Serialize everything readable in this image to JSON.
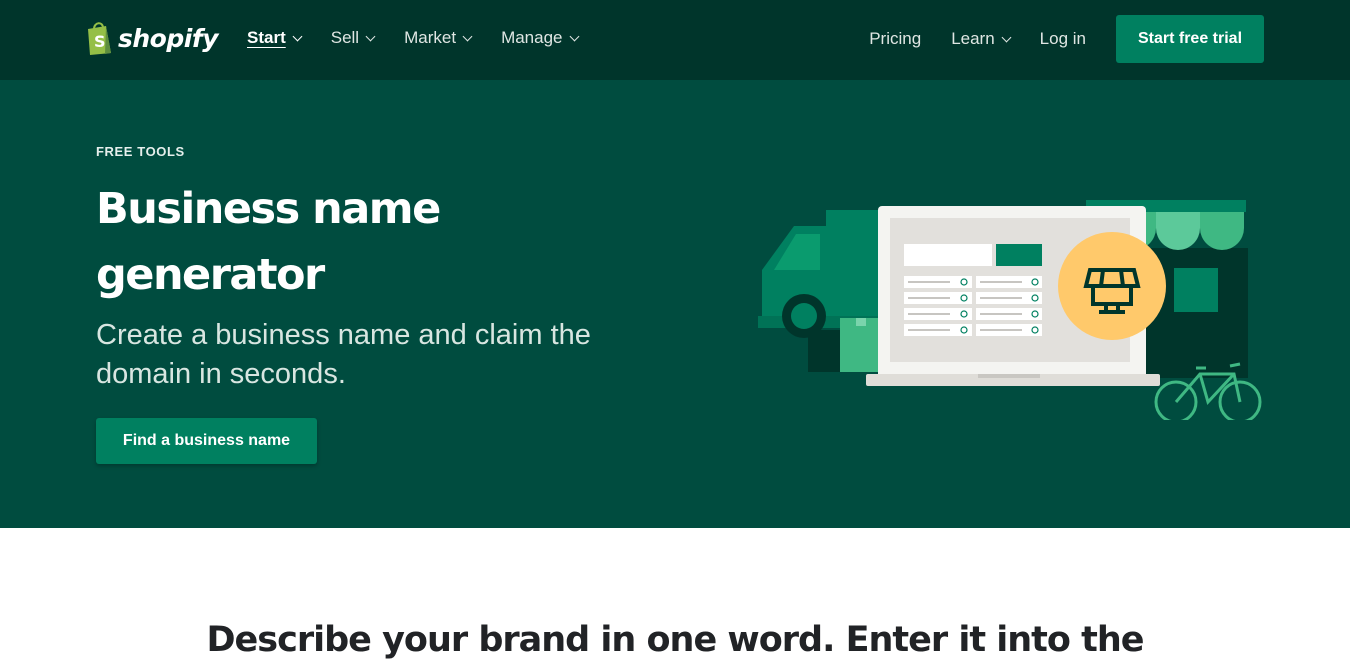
{
  "header": {
    "brand": "shopify",
    "nav_left": [
      {
        "label": "Start",
        "active": true
      },
      {
        "label": "Sell",
        "active": false
      },
      {
        "label": "Market",
        "active": false
      },
      {
        "label": "Manage",
        "active": false
      }
    ],
    "nav_right": {
      "pricing": "Pricing",
      "learn": "Learn",
      "login": "Log in",
      "cta": "Start free trial"
    }
  },
  "hero": {
    "eyebrow": "FREE TOOLS",
    "title": "Business name generator",
    "subtitle": "Create a business name and claim the domain in seconds.",
    "cta": "Find a business name"
  },
  "section2": {
    "heading": "Describe your brand in one word. Enter it into the"
  },
  "colors": {
    "header_bg": "#00352b",
    "hero_bg": "#004c3f",
    "accent": "#008060",
    "light_green": "#3fb883",
    "yellow": "#ffc96b"
  },
  "icons": [
    "shopify-bag-icon",
    "chevron-down-icon",
    "storefront-icon",
    "delivery-truck-icon",
    "bicycle-icon",
    "laptop-icon"
  ]
}
